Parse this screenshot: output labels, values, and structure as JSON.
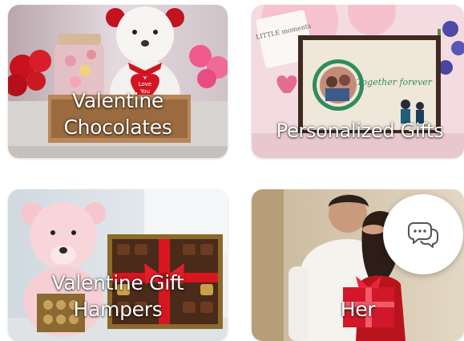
{
  "categories": [
    {
      "label_lines": [
        "Valentine",
        "Chocolates"
      ],
      "image": "teddy-bear-with-chocolates-image"
    },
    {
      "label_lines": [
        "Personalized Gifts"
      ],
      "image": "personalized-photo-frame-image",
      "frame_text": "Together forever",
      "card_text": "LITTLE moments"
    },
    {
      "label_lines": [
        "Valentine Gift",
        "Hampers"
      ],
      "image": "teddy-bear-with-chocolate-box-image"
    },
    {
      "label_lines": [
        "Her"
      ],
      "image": "couple-gift-surprise-image"
    }
  ],
  "teddy_heart_text": [
    "Love",
    "You"
  ],
  "chat": {
    "icon": "chat-bubbles-icon"
  },
  "colors": {
    "chat_icon": "#555555",
    "label_text": "#ffffff"
  }
}
